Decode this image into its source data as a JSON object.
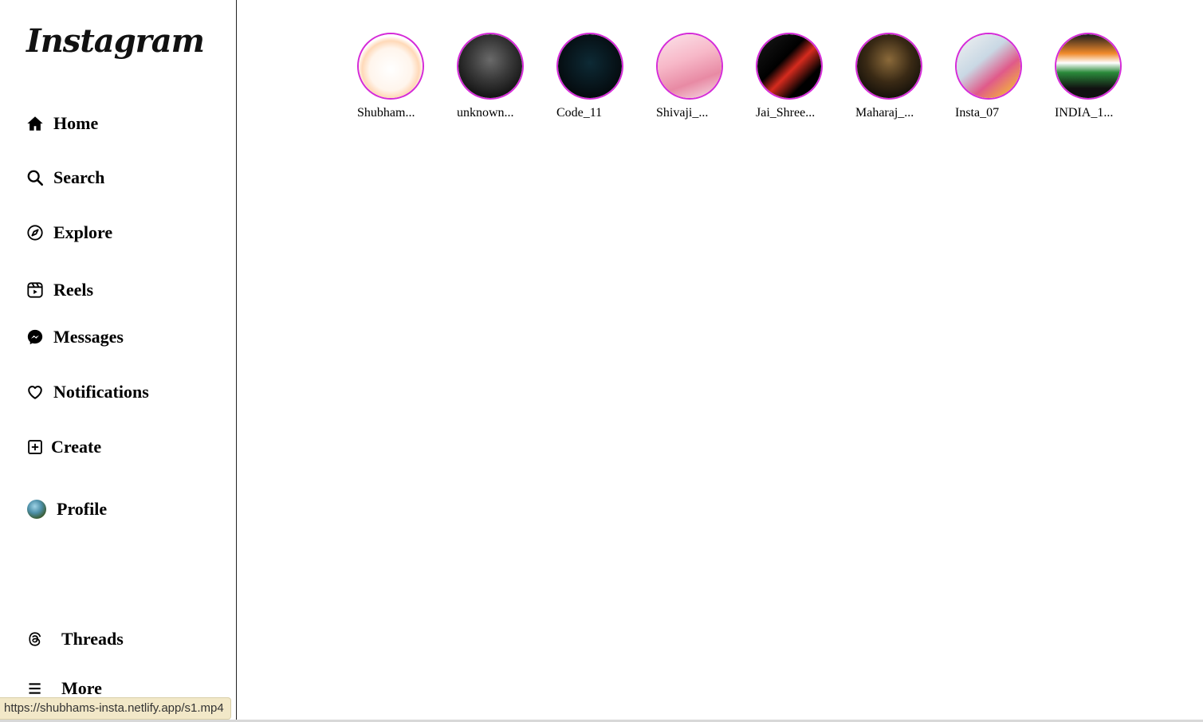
{
  "logo": {
    "text": "Instagram"
  },
  "sidebar": {
    "items": [
      {
        "label": "Home",
        "icon": "home-icon"
      },
      {
        "label": "Search",
        "icon": "search-icon"
      },
      {
        "label": "Explore",
        "icon": "compass-icon"
      },
      {
        "label": "Reels",
        "icon": "reels-icon"
      },
      {
        "label": "Messages",
        "icon": "messenger-icon"
      },
      {
        "label": "Notifications",
        "icon": "heart-icon"
      },
      {
        "label": "Create",
        "icon": "plus-square-icon"
      },
      {
        "label": "Profile",
        "icon": "profile-avatar"
      }
    ],
    "bottom": [
      {
        "label": "Threads",
        "icon": "threads-icon"
      },
      {
        "label": "More",
        "icon": "menu-icon"
      }
    ]
  },
  "stories": [
    {
      "name": "Shubham..."
    },
    {
      "name": "unknown..."
    },
    {
      "name": "Code_11"
    },
    {
      "name": "Shivaji_..."
    },
    {
      "name": "Jai_Shree..."
    },
    {
      "name": "Maharaj_..."
    },
    {
      "name": "Insta_07"
    },
    {
      "name": "INDIA_1..."
    }
  ],
  "status_bar": {
    "url": "https://shubhams-insta.netlify.app/s1.mp4"
  },
  "colors": {
    "story_ring": "#d52bd8",
    "divider": "#222222"
  }
}
